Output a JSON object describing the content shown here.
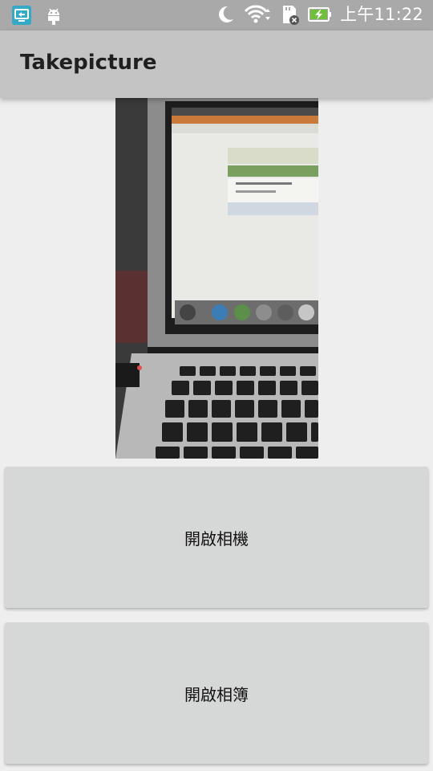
{
  "status_bar": {
    "time": "上午11:22",
    "icons": [
      "screen-cast-icon",
      "android-icon",
      "moon-icon",
      "wifi-icon",
      "sd-card-icon",
      "battery-charging-icon"
    ]
  },
  "app_bar": {
    "title": "Takepicture"
  },
  "photo": {
    "description_icon": "photo-preview"
  },
  "buttons": {
    "open_camera": "開啟相機",
    "open_album": "開啟相簿"
  },
  "colors": {
    "status_bar": "#a9a9a9",
    "app_bar": "#c4c4c4",
    "background": "#eeeeee",
    "button": "#d6d7d7"
  }
}
